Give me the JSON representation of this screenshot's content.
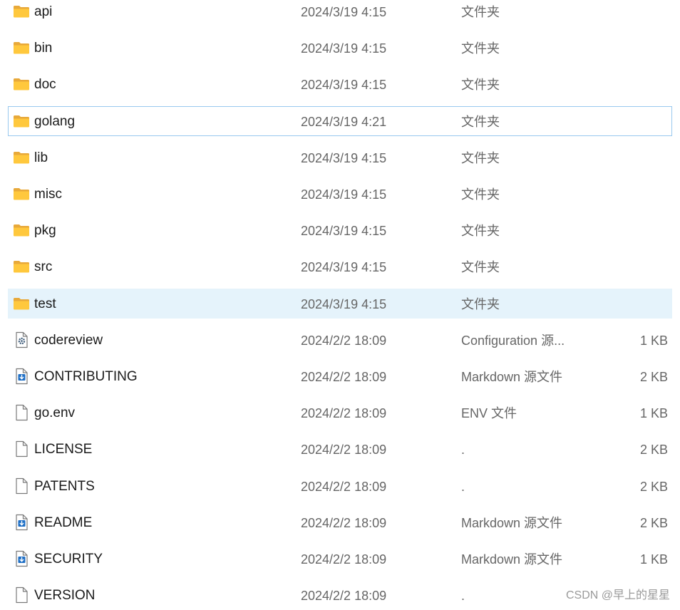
{
  "files": [
    {
      "name": "api",
      "date": "2024/3/19 4:15",
      "type": "文件夹",
      "size": "",
      "icon": "folder-icon",
      "state": ""
    },
    {
      "name": "bin",
      "date": "2024/3/19 4:15",
      "type": "文件夹",
      "size": "",
      "icon": "folder-icon",
      "state": ""
    },
    {
      "name": "doc",
      "date": "2024/3/19 4:15",
      "type": "文件夹",
      "size": "",
      "icon": "folder-icon",
      "state": ""
    },
    {
      "name": "golang",
      "date": "2024/3/19 4:21",
      "type": "文件夹",
      "size": "",
      "icon": "folder-icon",
      "state": "focused"
    },
    {
      "name": "lib",
      "date": "2024/3/19 4:15",
      "type": "文件夹",
      "size": "",
      "icon": "folder-icon",
      "state": ""
    },
    {
      "name": "misc",
      "date": "2024/3/19 4:15",
      "type": "文件夹",
      "size": "",
      "icon": "folder-icon",
      "state": ""
    },
    {
      "name": "pkg",
      "date": "2024/3/19 4:15",
      "type": "文件夹",
      "size": "",
      "icon": "folder-icon",
      "state": ""
    },
    {
      "name": "src",
      "date": "2024/3/19 4:15",
      "type": "文件夹",
      "size": "",
      "icon": "folder-icon",
      "state": ""
    },
    {
      "name": "test",
      "date": "2024/3/19 4:15",
      "type": "文件夹",
      "size": "",
      "icon": "folder-icon",
      "state": "selected"
    },
    {
      "name": "codereview",
      "date": "2024/2/2 18:09",
      "type": "Configuration 源...",
      "size": "1 KB",
      "icon": "config-file-icon",
      "state": ""
    },
    {
      "name": "CONTRIBUTING",
      "date": "2024/2/2 18:09",
      "type": "Markdown 源文件",
      "size": "2 KB",
      "icon": "markdown-file-icon",
      "state": ""
    },
    {
      "name": "go.env",
      "date": "2024/2/2 18:09",
      "type": "ENV 文件",
      "size": "1 KB",
      "icon": "blank-file-icon",
      "state": ""
    },
    {
      "name": "LICENSE",
      "date": "2024/2/2 18:09",
      "type": ".",
      "size": "2 KB",
      "icon": "blank-file-icon",
      "state": ""
    },
    {
      "name": "PATENTS",
      "date": "2024/2/2 18:09",
      "type": ".",
      "size": "2 KB",
      "icon": "blank-file-icon",
      "state": ""
    },
    {
      "name": "README",
      "date": "2024/2/2 18:09",
      "type": "Markdown 源文件",
      "size": "2 KB",
      "icon": "markdown-file-icon",
      "state": ""
    },
    {
      "name": "SECURITY",
      "date": "2024/2/2 18:09",
      "type": "Markdown 源文件",
      "size": "1 KB",
      "icon": "markdown-file-icon",
      "state": ""
    },
    {
      "name": "VERSION",
      "date": "2024/2/2 18:09",
      "type": ".",
      "size": "",
      "icon": "blank-file-icon",
      "state": ""
    }
  ],
  "watermark": "CSDN @早上的星星",
  "colors": {
    "selected_background": "#e5f3fb",
    "focus_border": "#99c9ef",
    "folder_yellow": "#ffc83d",
    "markdown_blue": "#1f6fc5",
    "secondary_text": "#666666"
  }
}
